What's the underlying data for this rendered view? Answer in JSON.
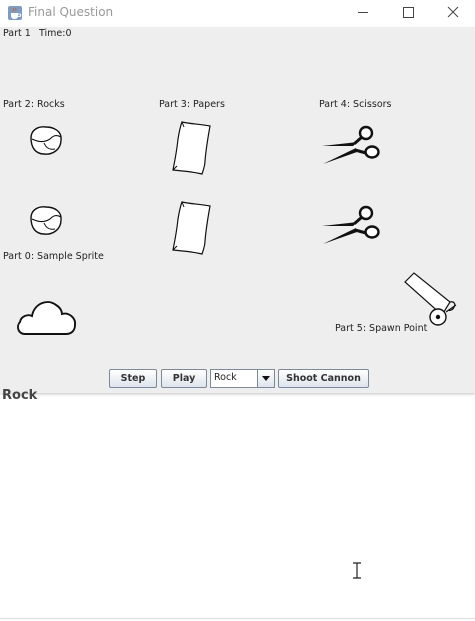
{
  "window": {
    "title": "Final Question",
    "icon": "java-cup-icon",
    "controls": [
      "minimize-icon",
      "maximize-icon",
      "close-icon"
    ]
  },
  "canvas": {
    "part1_label": "Part 1",
    "time_label": "Time:0",
    "part2_label": "Part 2: Rocks",
    "part3_label": "Part 3: Papers",
    "part4_label": "Part 4: Scissors",
    "part0_label": "Part 0: Sample Sprite",
    "part5_label": "Part 5: Spawn Point"
  },
  "toolbar": {
    "step_label": "Step",
    "play_label": "Play",
    "select_value": "Rock",
    "shoot_label": "Shoot Cannon"
  },
  "output": {
    "text": "Rock"
  }
}
